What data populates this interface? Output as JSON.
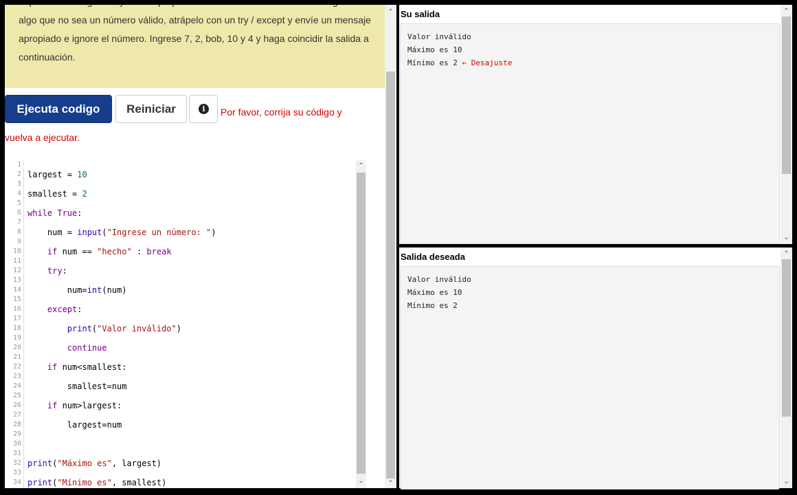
{
  "instructions": {
    "line_cut": "Imprima el más grande y el más pequeño de los números. Si el usuario ingresa",
    "text": "algo que no sea un número válido, atrápelo con un try / except y envíe un mensaje apropiado e ignore el número. Ingrese 7, 2, bob, 10 y 4 y haga coincidir la salida a continuación."
  },
  "toolbar": {
    "run_label": "Ejecuta codigo",
    "reset_label": "Reiniciar",
    "info_glyph": "i",
    "error_message": "Por favor, corrija su código y vuelva a ejecutar."
  },
  "editor": {
    "line_numbers": [
      "1",
      "2",
      "3",
      "4",
      "5",
      "6",
      "7",
      "8",
      "9",
      "10",
      "11",
      "12",
      "13",
      "14",
      "15",
      "16",
      "17",
      "18",
      "19",
      "20",
      "21",
      "22",
      "23",
      "24",
      "25",
      "26",
      "27",
      "28",
      "29",
      "30",
      "31",
      "32",
      "33",
      "34"
    ],
    "lines": [
      "largest = 10",
      "smallest = 2",
      "while True:",
      "    num = input(\"Ingrese un número: \")",
      "    if num == \"hecho\" : break",
      "    try:",
      "        num=int(num)",
      "    except:",
      "        print(\"Valor inválido\")",
      "        continue",
      "    if num<smallest:",
      "        smallest=num",
      "    if num>largest:",
      "        largest=num",
      "",
      "print(\"Máximo es\", largest)",
      "print(\"Mínimo es\", smallest)"
    ]
  },
  "output": {
    "title": "Su salida",
    "lines": [
      "Valor inválido",
      "Máximo es 10",
      "Mínimo es 2"
    ],
    "mismatch_marker": "← Desajuste"
  },
  "desired": {
    "title": "Salida deseada",
    "lines": [
      "Valor inválido",
      "Máximo es 10",
      "Mínimo es 2"
    ]
  },
  "icons": {
    "scroll_up": "scroll-up-arrow-icon",
    "scroll_down": "scroll-down-arrow-icon",
    "info": "info-icon"
  }
}
